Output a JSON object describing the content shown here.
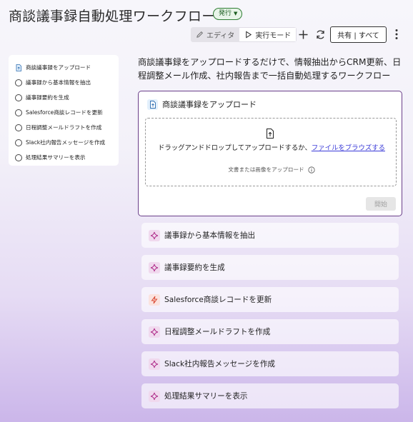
{
  "header": {
    "title": "商談議事録自動処理ワークフロー",
    "status_badge": "発行"
  },
  "toolbar": {
    "editor_label": "エディタ",
    "run_mode_label": "実行モード",
    "share_label": "共有 | すべて",
    "icons": [
      "pencil-icon",
      "play-icon",
      "plus-icon",
      "refresh-icon",
      "more-vertical-icon"
    ]
  },
  "sidebar": {
    "items": [
      {
        "label": "商談議事録をアップロード",
        "icon": "file-upload-icon"
      },
      {
        "label": "議事録から基本情報を抽出",
        "icon": "circle-icon"
      },
      {
        "label": "議事録要約を生成",
        "icon": "circle-icon"
      },
      {
        "label": "Salesforce商談レコードを更新",
        "icon": "circle-icon"
      },
      {
        "label": "日程調整メールドラフトを作成",
        "icon": "circle-icon"
      },
      {
        "label": "Slack社内報告メッセージを作成",
        "icon": "circle-icon"
      },
      {
        "label": "処理結果サマリーを表示",
        "icon": "circle-icon"
      }
    ]
  },
  "main": {
    "description": "商談議事録をアップロードするだけで、情報抽出からCRM更新、日程調整メール作成、社内報告まで一括自動処理するワークフロー",
    "upload": {
      "title": "商談議事録をアップロード",
      "drop_text": "ドラッグアンドドロップしてアップロードするか、",
      "browse_link": "ファイルをブラウズする",
      "hint": "文書または画像をアップロード",
      "start_label": "開始"
    },
    "steps": [
      {
        "label": "議事録から基本情報を抽出",
        "icon": "sparkle-icon"
      },
      {
        "label": "議事録要約を生成",
        "icon": "sparkle-icon"
      },
      {
        "label": "Salesforce商談レコードを更新",
        "icon": "bolt-icon"
      },
      {
        "label": "日程調整メールドラフトを作成",
        "icon": "sparkle-icon"
      },
      {
        "label": "Slack社内報告メッセージを作成",
        "icon": "sparkle-icon"
      },
      {
        "label": "処理結果サマリーを表示",
        "icon": "sparkle-icon"
      }
    ]
  },
  "colors": {
    "accent_border": "#6b3f8a",
    "publish_green": "#2e7d32",
    "link": "#3b3bd8"
  }
}
